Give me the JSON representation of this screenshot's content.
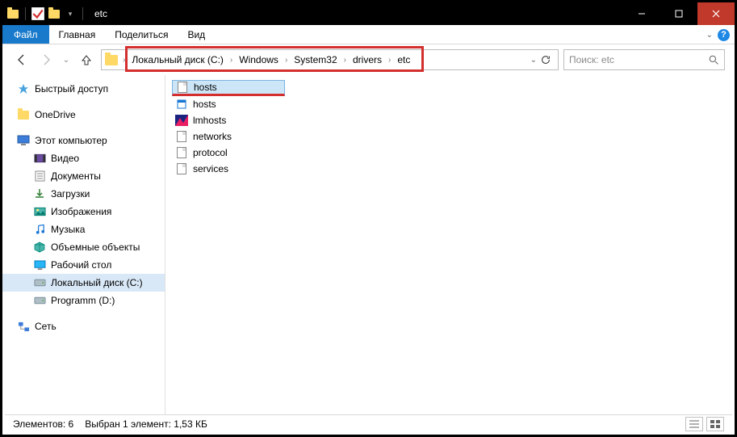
{
  "window": {
    "title": "etc"
  },
  "ribbon": {
    "file": "Файл",
    "tabs": [
      "Главная",
      "Поделиться",
      "Вид"
    ]
  },
  "address": {
    "crumbs": [
      "Локальный диск (C:)",
      "Windows",
      "System32",
      "drivers",
      "etc"
    ]
  },
  "search": {
    "placeholder": "Поиск: etc"
  },
  "sidebar": {
    "quick_access": "Быстрый доступ",
    "onedrive": "OneDrive",
    "this_pc": "Этот компьютер",
    "items": [
      {
        "label": "Видео",
        "icon": "video"
      },
      {
        "label": "Документы",
        "icon": "doc"
      },
      {
        "label": "Загрузки",
        "icon": "download"
      },
      {
        "label": "Изображения",
        "icon": "image"
      },
      {
        "label": "Музыка",
        "icon": "music"
      },
      {
        "label": "Объемные объекты",
        "icon": "3d"
      },
      {
        "label": "Рабочий стол",
        "icon": "desktop"
      },
      {
        "label": "Локальный диск (C:)",
        "icon": "drive",
        "selected": true
      },
      {
        "label": "Programm (D:)",
        "icon": "drive"
      }
    ],
    "network": "Сеть"
  },
  "files": [
    {
      "name": "hosts",
      "icon": "file",
      "selected": true,
      "underline": true
    },
    {
      "name": "hosts",
      "icon": "small"
    },
    {
      "name": "lmhosts",
      "icon": "colored"
    },
    {
      "name": "networks",
      "icon": "file"
    },
    {
      "name": "protocol",
      "icon": "file"
    },
    {
      "name": "services",
      "icon": "file"
    }
  ],
  "status": {
    "count_label": "Элементов: 6",
    "selection_label": "Выбран 1 элемент: 1,53 КБ"
  }
}
